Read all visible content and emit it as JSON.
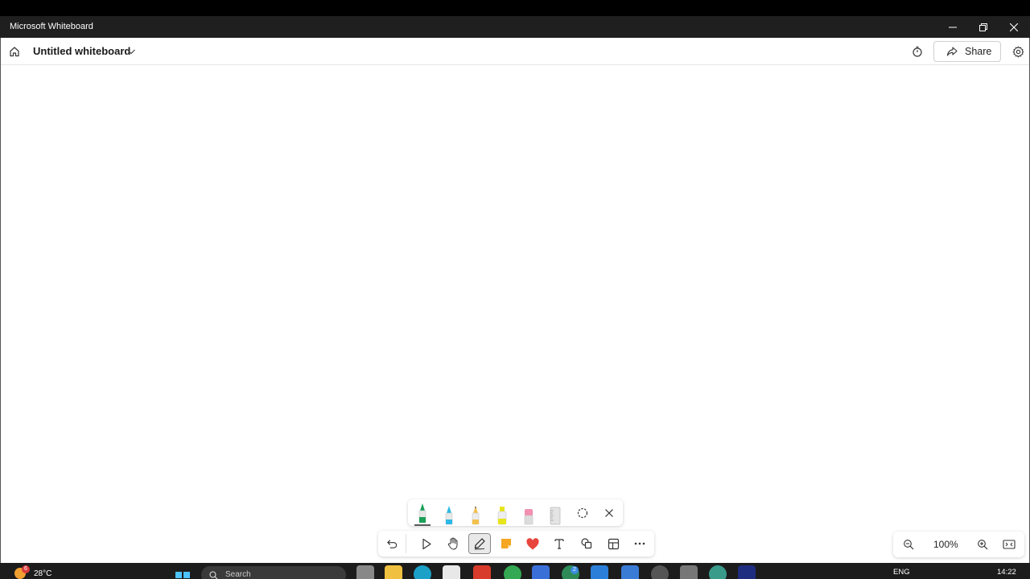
{
  "window": {
    "app_title": "Microsoft Whiteboard"
  },
  "header": {
    "board_title": "Untitled whiteboard",
    "share_label": "Share"
  },
  "pen_tray": {
    "items": [
      "green-pen",
      "blue-pen",
      "yellow-pencil",
      "highlighter",
      "eraser",
      "ruler",
      "lasso",
      "close"
    ],
    "colors": {
      "green": "#1aa058",
      "blue": "#2eb8e6",
      "yellow": "#f2c14e",
      "highlighter": "#e7e51c",
      "pink": "#f28fb2"
    }
  },
  "toolbar": {
    "items": [
      "undo",
      "select",
      "pan",
      "inking",
      "sticky-note",
      "reactions",
      "text",
      "shapes",
      "templates",
      "more"
    ],
    "active": "inking"
  },
  "zoom": {
    "level": "100%"
  },
  "taskbar": {
    "weather_badge": "6",
    "temperature": "28°C",
    "search_placeholder": "Search",
    "teams_badge": "2",
    "language": "ENG",
    "time": "14:22"
  }
}
